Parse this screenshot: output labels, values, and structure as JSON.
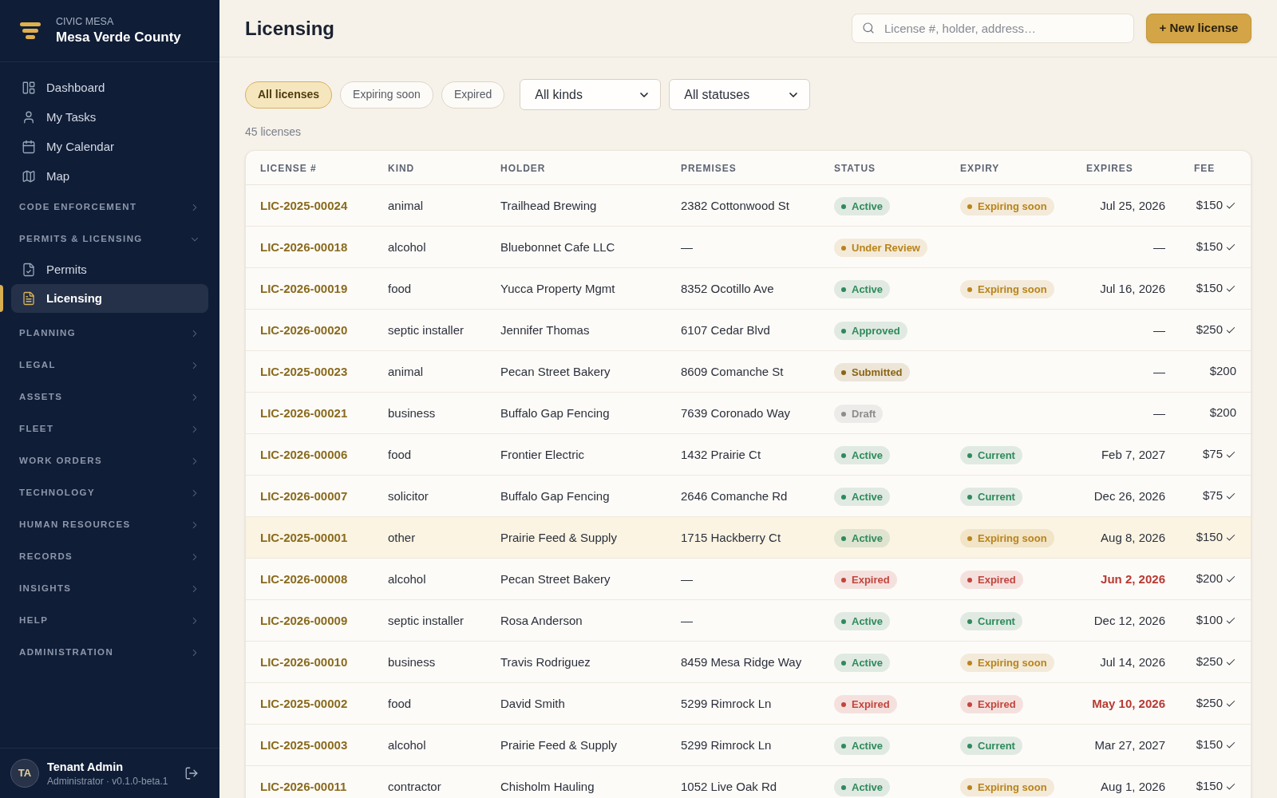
{
  "sidebar": {
    "brand": {
      "org": "CIVIC MESA",
      "name": "Mesa Verde County"
    },
    "nav": [
      {
        "label": "Dashboard",
        "selected": false
      },
      {
        "label": "My Tasks",
        "selected": false
      },
      {
        "label": "My Calendar",
        "selected": false
      },
      {
        "label": "Map",
        "selected": false
      }
    ],
    "sections": [
      {
        "label": "CODE ENFORCEMENT",
        "expanded": false
      },
      {
        "label": "PERMITS & LICENSING",
        "expanded": true,
        "children": [
          {
            "label": "Permits",
            "selected": false
          },
          {
            "label": "Licensing",
            "selected": true
          }
        ]
      },
      {
        "label": "PLANNING",
        "expanded": false
      },
      {
        "label": "LEGAL",
        "expanded": false
      },
      {
        "label": "ASSETS",
        "expanded": false
      },
      {
        "label": "FLEET",
        "expanded": false
      },
      {
        "label": "WORK ORDERS",
        "expanded": false
      },
      {
        "label": "TECHNOLOGY",
        "expanded": false
      },
      {
        "label": "HUMAN RESOURCES",
        "expanded": false
      },
      {
        "label": "RECORDS",
        "expanded": false
      },
      {
        "label": "INSIGHTS",
        "expanded": false
      },
      {
        "label": "HELP",
        "expanded": false
      },
      {
        "label": "ADMINISTRATION",
        "expanded": false
      }
    ],
    "user": {
      "initials": "TA",
      "name": "Tenant Admin",
      "role": "Administrator · v0.1.0-beta.1"
    }
  },
  "header": {
    "title": "Licensing",
    "search": {
      "placeholder": "License #, holder, address…"
    },
    "new_button": "+ New license"
  },
  "filters": {
    "pills": [
      {
        "label": "All licenses",
        "selected": true
      },
      {
        "label": "Expiring soon",
        "selected": false
      },
      {
        "label": "Expired",
        "selected": false
      }
    ],
    "selects": [
      {
        "value": "All kinds"
      },
      {
        "value": "All statuses"
      }
    ]
  },
  "count": "45 licenses",
  "table": {
    "columns": [
      "LICENSE #",
      "KIND",
      "HOLDER",
      "PREMISES",
      "STATUS",
      "EXPIRY",
      "EXPIRES",
      "FEE"
    ],
    "rows": [
      {
        "license": "LIC-2025-00024",
        "license_kind": "animal",
        "holder": "Trailhead Brewing",
        "premises": "2382 Cottonwood St",
        "status": {
          "label": "Active",
          "color": "#2f8a5b"
        },
        "expiry": {
          "label": "Expiring soon",
          "color": "#b8841c"
        },
        "expires": "Jul 25, 2026",
        "overdue": false,
        "fee": "$150",
        "paid": true,
        "selected": false
      },
      {
        "license": "LIC-2026-00018",
        "license_kind": "alcohol",
        "holder": "Bluebonnet Cafe LLC",
        "premises": "—",
        "status": {
          "label": "Under Review",
          "color": "#b8841c"
        },
        "expires": "—",
        "overdue": false,
        "fee": "$150",
        "paid": true,
        "selected": false
      },
      {
        "license": "LIC-2026-00019",
        "license_kind": "food",
        "holder": "Yucca Property Mgmt",
        "premises": "8352 Ocotillo Ave",
        "status": {
          "label": "Active",
          "color": "#2f8a5b"
        },
        "expiry": {
          "label": "Expiring soon",
          "color": "#b8841c"
        },
        "expires": "Jul 16, 2026",
        "overdue": false,
        "fee": "$150",
        "paid": true,
        "selected": false
      },
      {
        "license": "LIC-2026-00020",
        "license_kind": "septic installer",
        "holder": "Jennifer Thomas",
        "premises": "6107 Cedar Blvd",
        "status": {
          "label": "Approved",
          "color": "#2f8a5b"
        },
        "expires": "—",
        "overdue": false,
        "fee": "$250",
        "paid": true,
        "selected": false
      },
      {
        "license": "LIC-2025-00023",
        "license_kind": "animal",
        "holder": "Pecan Street Bakery",
        "premises": "8609 Comanche St",
        "status": {
          "label": "Submitted",
          "color": "#8a6514"
        },
        "expires": "—",
        "overdue": false,
        "fee": "$200",
        "paid": false,
        "selected": false
      },
      {
        "license": "LIC-2026-00021",
        "license_kind": "business",
        "holder": "Buffalo Gap Fencing",
        "premises": "7639 Coronado Way",
        "status": {
          "label": "Draft",
          "color": "#8c8c8c"
        },
        "expires": "—",
        "overdue": false,
        "fee": "$200",
        "paid": false,
        "selected": false
      },
      {
        "license": "LIC-2026-00006",
        "license_kind": "food",
        "holder": "Frontier Electric",
        "premises": "1432 Prairie Ct",
        "status": {
          "label": "Active",
          "color": "#2f8a5b"
        },
        "expiry": {
          "label": "Current",
          "color": "#2f8a5b"
        },
        "expires": "Feb 7, 2027",
        "overdue": false,
        "fee": "$75",
        "paid": true,
        "selected": false
      },
      {
        "license": "LIC-2026-00007",
        "license_kind": "solicitor",
        "holder": "Buffalo Gap Fencing",
        "premises": "2646 Comanche Rd",
        "status": {
          "label": "Active",
          "color": "#2f8a5b"
        },
        "expiry": {
          "label": "Current",
          "color": "#2f8a5b"
        },
        "expires": "Dec 26, 2026",
        "overdue": false,
        "fee": "$75",
        "paid": true,
        "selected": false
      },
      {
        "license": "LIC-2025-00001",
        "license_kind": "other",
        "holder": "Prairie Feed & Supply",
        "premises": "1715 Hackberry Ct",
        "status": {
          "label": "Active",
          "color": "#2f8a5b"
        },
        "expiry": {
          "label": "Expiring soon",
          "color": "#b8841c"
        },
        "expires": "Aug 8, 2026",
        "overdue": false,
        "fee": "$150",
        "paid": true,
        "selected": true
      },
      {
        "license": "LIC-2026-00008",
        "license_kind": "alcohol",
        "holder": "Pecan Street Bakery",
        "premises": "—",
        "status": {
          "label": "Expired",
          "color": "#c2453d"
        },
        "expiry": {
          "label": "Expired",
          "color": "#c2453d"
        },
        "expires": "Jun 2, 2026",
        "overdue": true,
        "fee": "$200",
        "paid": true,
        "selected": false
      },
      {
        "license": "LIC-2026-00009",
        "license_kind": "septic installer",
        "holder": "Rosa Anderson",
        "premises": "—",
        "status": {
          "label": "Active",
          "color": "#2f8a5b"
        },
        "expiry": {
          "label": "Current",
          "color": "#2f8a5b"
        },
        "expires": "Dec 12, 2026",
        "overdue": false,
        "fee": "$100",
        "paid": true,
        "selected": false
      },
      {
        "license": "LIC-2026-00010",
        "license_kind": "business",
        "holder": "Travis Rodriguez",
        "premises": "8459 Mesa Ridge Way",
        "status": {
          "label": "Active",
          "color": "#2f8a5b"
        },
        "expiry": {
          "label": "Expiring soon",
          "color": "#b8841c"
        },
        "expires": "Jul 14, 2026",
        "overdue": false,
        "fee": "$250",
        "paid": true,
        "selected": false
      },
      {
        "license": "LIC-2025-00002",
        "license_kind": "food",
        "holder": "David Smith",
        "premises": "5299 Rimrock Ln",
        "status": {
          "label": "Expired",
          "color": "#c2453d"
        },
        "expiry": {
          "label": "Expired",
          "color": "#c2453d"
        },
        "expires": "May 10, 2026",
        "overdue": true,
        "fee": "$250",
        "paid": true,
        "selected": false
      },
      {
        "license": "LIC-2025-00003",
        "license_kind": "alcohol",
        "holder": "Prairie Feed & Supply",
        "premises": "5299 Rimrock Ln",
        "status": {
          "label": "Active",
          "color": "#2f8a5b"
        },
        "expiry": {
          "label": "Current",
          "color": "#2f8a5b"
        },
        "expires": "Mar 27, 2027",
        "overdue": false,
        "fee": "$150",
        "paid": true,
        "selected": false
      },
      {
        "license": "LIC-2026-00011",
        "license_kind": "contractor",
        "holder": "Chisholm Hauling",
        "premises": "1052 Live Oak Rd",
        "status": {
          "label": "Active",
          "color": "#2f8a5b"
        },
        "expiry": {
          "label": "Expiring soon",
          "color": "#b8841c"
        },
        "expires": "Aug 1, 2026",
        "overdue": false,
        "fee": "$150",
        "paid": true,
        "selected": false
      }
    ]
  }
}
